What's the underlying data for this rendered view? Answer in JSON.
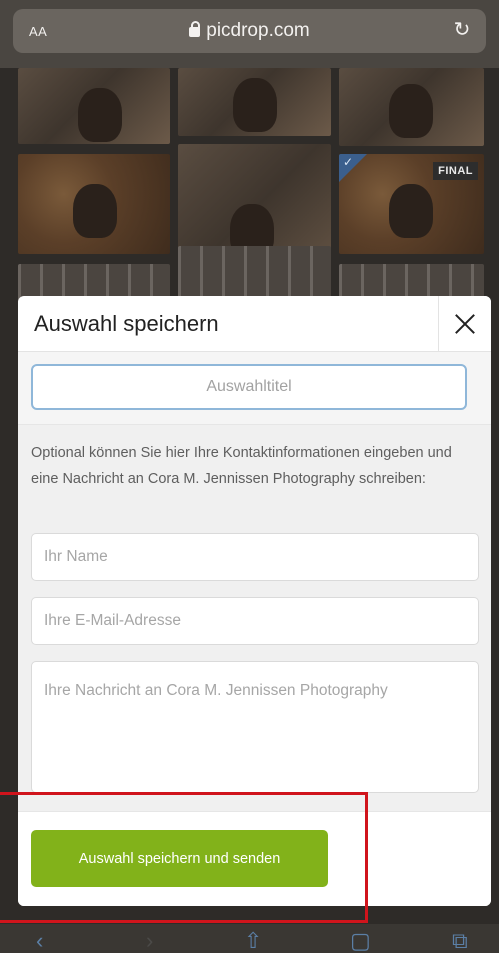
{
  "browser": {
    "text_size_label": "AA",
    "domain": "picdrop.com",
    "icons": {
      "lock": "lock-icon",
      "reload": "reload-icon"
    }
  },
  "gallery": {
    "badge_final": "FINAL"
  },
  "modal": {
    "title": "Auswahl speichern",
    "close_icon": "close-icon",
    "selection_title_placeholder": "Auswahltitel",
    "hint": "Optional können Sie hier Ihre Kontaktinformationen eingeben und eine Nachricht an Cora M. Jennissen Photography schreiben:",
    "name_placeholder": "Ihr Name",
    "email_placeholder": "Ihre E-Mail-Adresse",
    "message_placeholder": "Ihre Nachricht an Cora M. Jennissen Photography",
    "submit_label": "Auswahl speichern und senden"
  },
  "colors": {
    "accent_green": "#82b21a",
    "focus_blue": "#8fb7d9",
    "highlight_red": "#d0141c"
  },
  "toolbar": {
    "icons": [
      "back-icon",
      "forward-icon",
      "share-icon",
      "bookmarks-icon",
      "tabs-icon"
    ]
  }
}
